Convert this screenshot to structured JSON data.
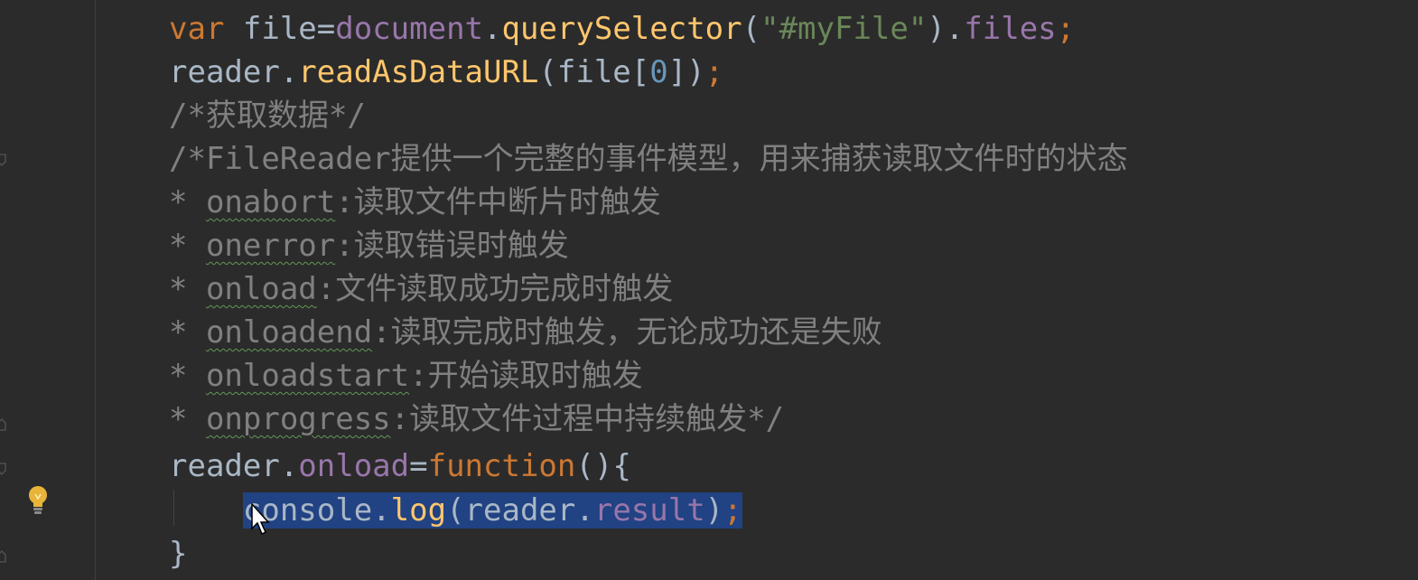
{
  "colors": {
    "background": "#2b2b2b",
    "keyword": "#cc7832",
    "function": "#ffc66d",
    "property": "#9876aa",
    "string": "#6a8759",
    "number": "#6897bb",
    "comment": "#808080",
    "plain": "#a9b7c6",
    "selection": "#214283"
  },
  "icons": {
    "gutter": [
      "fold-marker-icon",
      "fold-marker-icon",
      "fold-marker-icon",
      "fold-marker-icon",
      "lightbulb-icon"
    ],
    "pointer": "mouse-cursor-icon"
  },
  "code": {
    "line1": {
      "kw": "var",
      "sp": " file=",
      "obj": "document",
      "dot": ".",
      "fn": "querySelector",
      "open": "(",
      "str": "\"#myFile\"",
      "close": ").",
      "prop": "files",
      "semi": ";"
    },
    "line2": {
      "obj": "reader.",
      "fn": "readAsDataURL",
      "a": "(file[",
      "num": "0",
      "b": "])",
      "semi": ";"
    },
    "line3": "/*获取数据*/",
    "line4": "/*FileReader提供一个完整的事件模型，用来捕获读取文件时的状态",
    "events": [
      {
        "star": "* ",
        "name": "onabort",
        "desc": ":读取文件中断片时触发"
      },
      {
        "star": "* ",
        "name": "onerror",
        "desc": ":读取错误时触发"
      },
      {
        "star": "* ",
        "name": "onload",
        "desc": ":文件读取成功完成时触发"
      },
      {
        "star": "* ",
        "name": "onloadend",
        "desc": ":读取完成时触发，无论成功还是失败"
      },
      {
        "star": "* ",
        "name": "onloadstart",
        "desc": ":开始读取时触发"
      },
      {
        "star": "* ",
        "name": "onprogress",
        "desc": ":读取文件过程中持续触发*/"
      }
    ],
    "line11": {
      "obj": "reader.",
      "prop": "onload",
      "eq": "=",
      "kw": "function",
      "rest": "(){"
    },
    "line12": {
      "indent": "    ",
      "a": "console.",
      "fn": "log",
      "b": "(reader.",
      "prop": "result",
      "c": ")",
      "semi": ";"
    },
    "line13": "}"
  }
}
